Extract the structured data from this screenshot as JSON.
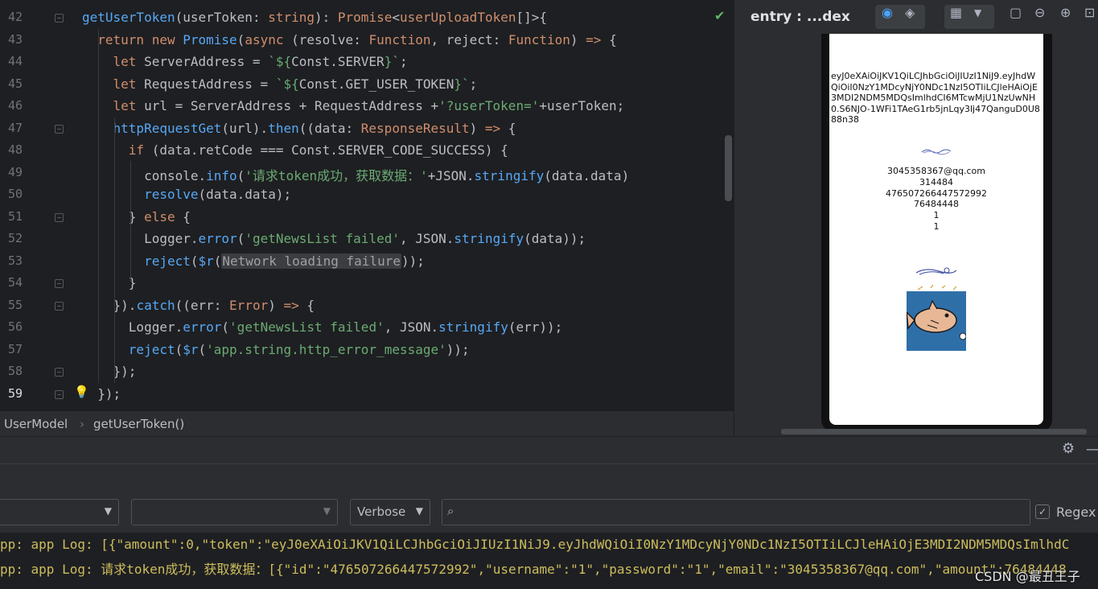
{
  "editor": {
    "line_numbers": [
      "42",
      "43",
      "44",
      "45",
      "46",
      "47",
      "48",
      "49",
      "50",
      "51",
      "52",
      "53",
      "54",
      "55",
      "56",
      "57",
      "58",
      "59"
    ],
    "active_line": "59",
    "lines": [
      [
        [
          "fn",
          "getUserToken"
        ],
        [
          "op",
          "("
        ],
        [
          "id",
          "userToken"
        ],
        [
          "op",
          ": "
        ],
        [
          "pm",
          "string"
        ],
        [
          "op",
          "): "
        ],
        [
          "pm",
          "Promise"
        ],
        [
          "op",
          "<"
        ],
        [
          "pm",
          "userUploadToken"
        ],
        [
          "op",
          "[]>{"
        ]
      ],
      [
        [
          "op",
          "  "
        ],
        [
          "kw",
          "return new "
        ],
        [
          "fn",
          "Promise"
        ],
        [
          "op",
          "("
        ],
        [
          "kw",
          "async "
        ],
        [
          "op",
          "("
        ],
        [
          "id",
          "resolve"
        ],
        [
          "op",
          ": "
        ],
        [
          "pm",
          "Function"
        ],
        [
          "op",
          ", "
        ],
        [
          "id",
          "reject"
        ],
        [
          "op",
          ": "
        ],
        [
          "pm",
          "Function"
        ],
        [
          "op",
          ") "
        ],
        [
          "kw",
          "=>"
        ],
        [
          "op",
          " {"
        ]
      ],
      [
        [
          "op",
          "    "
        ],
        [
          "kw",
          "let "
        ],
        [
          "id",
          "ServerAddress = "
        ],
        [
          "str",
          "`${"
        ],
        [
          "id",
          "Const.SERVER"
        ],
        [
          "str",
          "}`"
        ],
        [
          "op",
          ";"
        ]
      ],
      [
        [
          "op",
          "    "
        ],
        [
          "kw",
          "let "
        ],
        [
          "id",
          "RequestAddress = "
        ],
        [
          "str",
          "`${"
        ],
        [
          "id",
          "Const.GET_USER_TOKEN"
        ],
        [
          "str",
          "}`"
        ],
        [
          "op",
          ";"
        ]
      ],
      [
        [
          "op",
          "    "
        ],
        [
          "kw",
          "let "
        ],
        [
          "id",
          "url = ServerAddress + RequestAddress +"
        ],
        [
          "str",
          "'?userToken='"
        ],
        [
          "op",
          "+userToken;"
        ]
      ],
      [
        [
          "op",
          "    "
        ],
        [
          "fn",
          "httpRequestGet"
        ],
        [
          "op",
          "(url)."
        ],
        [
          "fn",
          "then"
        ],
        [
          "op",
          "(("
        ],
        [
          "id",
          "data"
        ],
        [
          "op",
          ": "
        ],
        [
          "pm",
          "ResponseResult"
        ],
        [
          "op",
          ") "
        ],
        [
          "kw",
          "=>"
        ],
        [
          "op",
          " {"
        ]
      ],
      [
        [
          "op",
          "      "
        ],
        [
          "kw",
          "if "
        ],
        [
          "op",
          "(data.retCode === Const.SERVER_CODE_SUCCESS) {"
        ]
      ],
      [
        [
          "op",
          "        console."
        ],
        [
          "fn",
          "info"
        ],
        [
          "op",
          "("
        ],
        [
          "str",
          "'请求token成功，获取数据：'"
        ],
        [
          "op",
          "+JSON."
        ],
        [
          "fn",
          "stringify"
        ],
        [
          "op",
          "(data.data)"
        ]
      ],
      [
        [
          "op",
          "        "
        ],
        [
          "fn",
          "resolve"
        ],
        [
          "op",
          "(data.data);"
        ]
      ],
      [
        [
          "op",
          "      } "
        ],
        [
          "kw",
          "else"
        ],
        [
          "op",
          " {"
        ]
      ],
      [
        [
          "op",
          "        Logger."
        ],
        [
          "fn",
          "error"
        ],
        [
          "op",
          "("
        ],
        [
          "str",
          "'getNewsList failed'"
        ],
        [
          "op",
          ", JSON."
        ],
        [
          "fn",
          "stringify"
        ],
        [
          "op",
          "(data));"
        ]
      ],
      [
        [
          "op",
          "        "
        ],
        [
          "fn",
          "reject"
        ],
        [
          "op",
          "("
        ],
        [
          "fn",
          "$r"
        ],
        [
          "op",
          "("
        ],
        [
          "hint",
          "Network loading failure"
        ],
        [
          "op",
          "));"
        ]
      ],
      [
        [
          "op",
          "      }"
        ]
      ],
      [
        [
          "op",
          "    })."
        ],
        [
          "fn",
          "catch"
        ],
        [
          "op",
          "(("
        ],
        [
          "id",
          "err"
        ],
        [
          "op",
          ": "
        ],
        [
          "pm",
          "Error"
        ],
        [
          "op",
          ") "
        ],
        [
          "kw",
          "=>"
        ],
        [
          "op",
          " {"
        ]
      ],
      [
        [
          "op",
          "      Logger."
        ],
        [
          "fn",
          "error"
        ],
        [
          "op",
          "("
        ],
        [
          "str",
          "'getNewsList failed'"
        ],
        [
          "op",
          ", JSON."
        ],
        [
          "fn",
          "stringify"
        ],
        [
          "op",
          "(err));"
        ]
      ],
      [
        [
          "op",
          "      "
        ],
        [
          "fn",
          "reject"
        ],
        [
          "op",
          "("
        ],
        [
          "fn",
          "$r"
        ],
        [
          "op",
          "("
        ],
        [
          "str",
          "'app.string.http_error_message'"
        ],
        [
          "op",
          "));"
        ]
      ],
      [
        [
          "op",
          "    });"
        ]
      ],
      [
        [
          "op",
          "  });"
        ]
      ]
    ]
  },
  "breadcrumb": {
    "class_name": "UserModel",
    "method_name": "getUserToken()"
  },
  "previewer": {
    "title": "entry : ...dex",
    "token_text": "eyJ0eXAiOiJKV1QiLCJhbGciOiJIUzI1NiJ9.eyJhdWQiOiI0NzY1MDcyNjY0NDc1NzI5OTIiLCJleHAiOjE3MDI2NDM5MDQsImlhdCI6MTcwMjU1NzUwNH0.S6NJO-1WFi1TAeG1rb5jnLqy3lj47QanguD0U888n38",
    "user_lines": [
      "3045358367@qq.com",
      "314484",
      "476507266447572992",
      "76484448",
      "1",
      "1"
    ]
  },
  "logcat": {
    "verbose_label": "Verbose",
    "search_placeholder": "",
    "regex_label": "Regex",
    "regex_checked": "✓",
    "lines": [
      "pp: app Log: [{\"amount\":0,\"token\":\"eyJ0eXAiOiJKV1QiLCJhbGciOiJIUzI1NiJ9.eyJhdWQiOiI0NzY1MDcyNjY0NDc1NzI5OTIiLCJleHAiOjE3MDI2NDM5MDQsImlhdC",
      "pp: app Log: 请求token成功，获取数据：[{\"id\":\"476507266447572992\",\"username\":\"1\",\"password\":\"1\",\"email\":\"3045358367@qq.com\",\"amount\":76484448"
    ]
  },
  "watermark": "CSDN @最丑王子"
}
